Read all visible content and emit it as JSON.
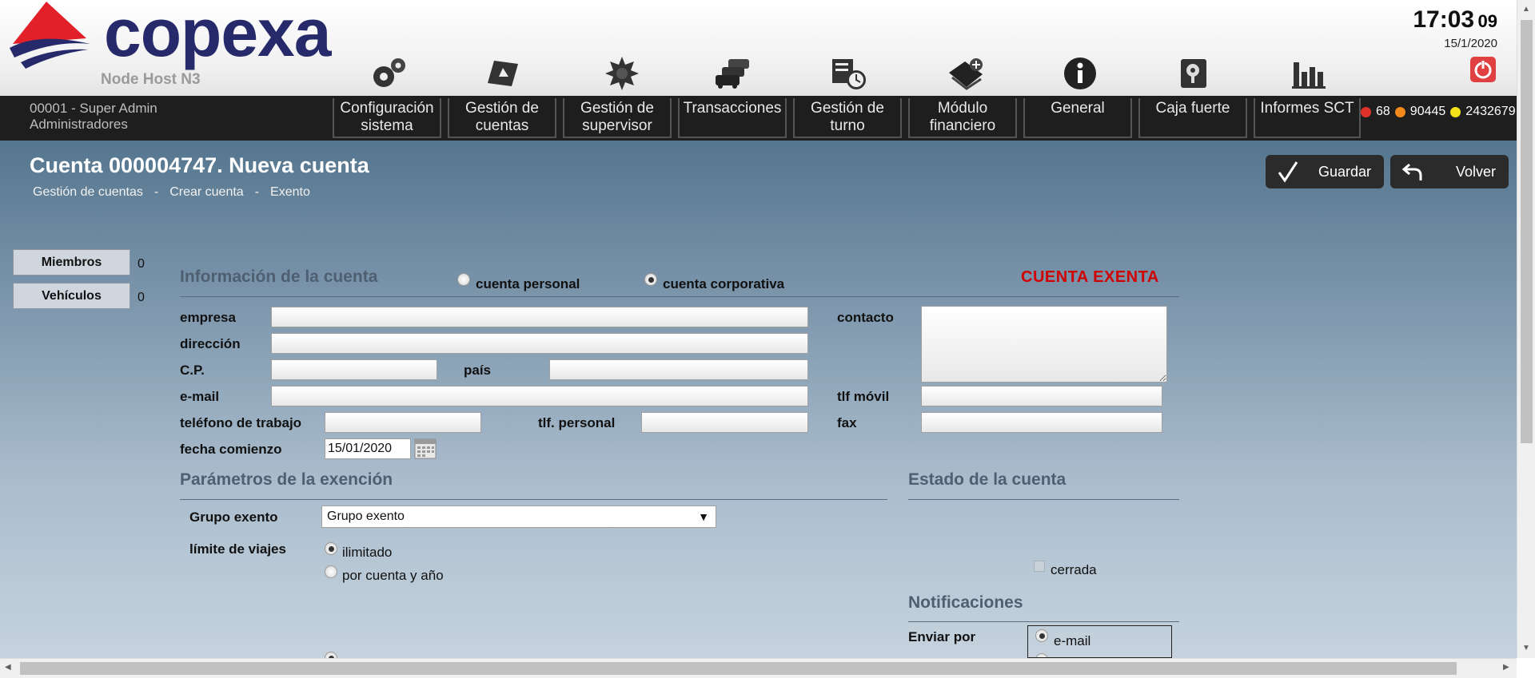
{
  "header": {
    "brand": "copexa",
    "node_host": "Node Host N3",
    "clock_time": "17:03",
    "clock_seconds": "09",
    "clock_date": "15/1/2020",
    "toolbar_icons": [
      "gears-icon",
      "account-card-icon",
      "sun-gear-icon",
      "traffic-cars-icon",
      "shift-clock-icon",
      "finance-wallet-icon",
      "info-icon",
      "safe-icon",
      "chart-bars-icon"
    ]
  },
  "nav": {
    "user_line1": "00001 - Super Admin",
    "user_line2": "Administradores",
    "tabs": [
      {
        "l1": "Configuración",
        "l2": "sistema"
      },
      {
        "l1": "Gestión de",
        "l2": "cuentas"
      },
      {
        "l1": "Gestión de",
        "l2": "supervisor"
      },
      {
        "l1": "Transacciones",
        "l2": ""
      },
      {
        "l1": "Gestión de",
        "l2": "turno"
      },
      {
        "l1": "Módulo",
        "l2": "financiero"
      },
      {
        "l1": "General",
        "l2": ""
      },
      {
        "l1": "Caja fuerte",
        "l2": ""
      },
      {
        "l1": "Informes SCT",
        "l2": ""
      }
    ],
    "counter_red": "68",
    "counter_orange": "90445",
    "counter_yellow": "2432679",
    "colors": {
      "red": "#e0322a",
      "orange": "#f08a1a",
      "yellow": "#f2e21a"
    }
  },
  "page": {
    "title": "Cuenta 000004747. Nueva cuenta",
    "breadcrumb": [
      "Gestión de cuentas",
      "Crear cuenta",
      "Exento"
    ],
    "save_label": "Guardar",
    "back_label": "Volver"
  },
  "side": {
    "miembros_label": "Miembros",
    "miembros_count": "0",
    "vehiculos_label": "Vehículos",
    "vehiculos_count": "0"
  },
  "account_info": {
    "section_title": "Información de la cuenta",
    "radio_personal": "cuenta personal",
    "radio_corporativa": "cuenta corporativa",
    "selected_type": "cuenta corporativa",
    "exempt_label": "CUENTA EXENTA",
    "labels": {
      "empresa": "empresa",
      "direccion": "dirección",
      "cp": "C.P.",
      "pais": "país",
      "email": "e-mail",
      "telefono_trabajo": "teléfono de trabajo",
      "tlf_personal": "tlf. personal",
      "fecha_comienzo": "fecha comienzo",
      "contacto": "contacto",
      "tlf_movil": "tlf móvil",
      "fax": "fax"
    },
    "fecha_comienzo_value": "15/01/2020"
  },
  "exemption": {
    "section_title": "Parámetros de la exención",
    "grupo_label": "Grupo exento",
    "grupo_value": "Grupo exento",
    "limite_label": "límite de viajes",
    "limite_opt1": "ilimitado",
    "limite_opt2": "por cuenta y año",
    "limite_selected": "ilimitado"
  },
  "status": {
    "section_title": "Estado de la cuenta",
    "cerrada_label": "cerrada",
    "cerrada_checked": false
  },
  "notifications": {
    "section_title": "Notificaciones",
    "enviar_label": "Enviar por",
    "option_email": "e-mail",
    "selected": "e-mail"
  }
}
